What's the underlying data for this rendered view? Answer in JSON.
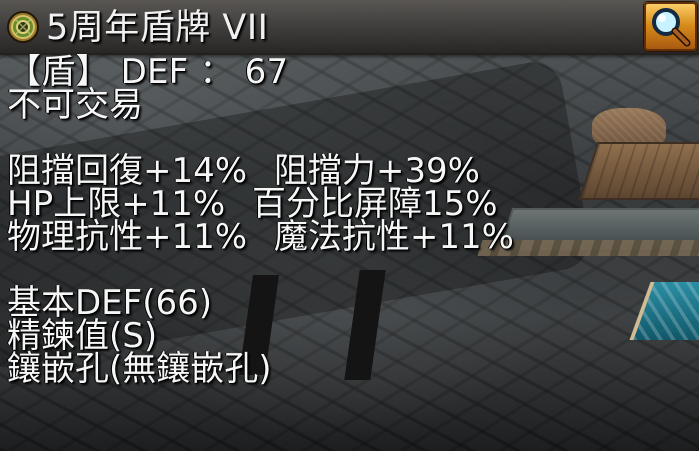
{
  "item": {
    "name": "5周年盾牌 VII",
    "icon": "round-shield-icon",
    "search_icon": "magnifier-icon"
  },
  "stats": {
    "defense_line": "【盾】 DEF ： 67",
    "trade_restriction": "不可交易",
    "bonuses": [
      [
        "阻擋回復+14%",
        "阻擋力+39%"
      ],
      [
        "HP上限+11%",
        "百分比屏障15%"
      ],
      [
        "物理抗性+11%",
        "魔法抗性+11%"
      ]
    ],
    "base_def": "基本DEF(66)",
    "refine_value": "精鍊值(S)",
    "socket": "鑲嵌孔(無鑲嵌孔)"
  },
  "colors": {
    "text": "#f6f6f6",
    "title_bar": "#4f4c49",
    "search_gold": "#d68a1a"
  }
}
